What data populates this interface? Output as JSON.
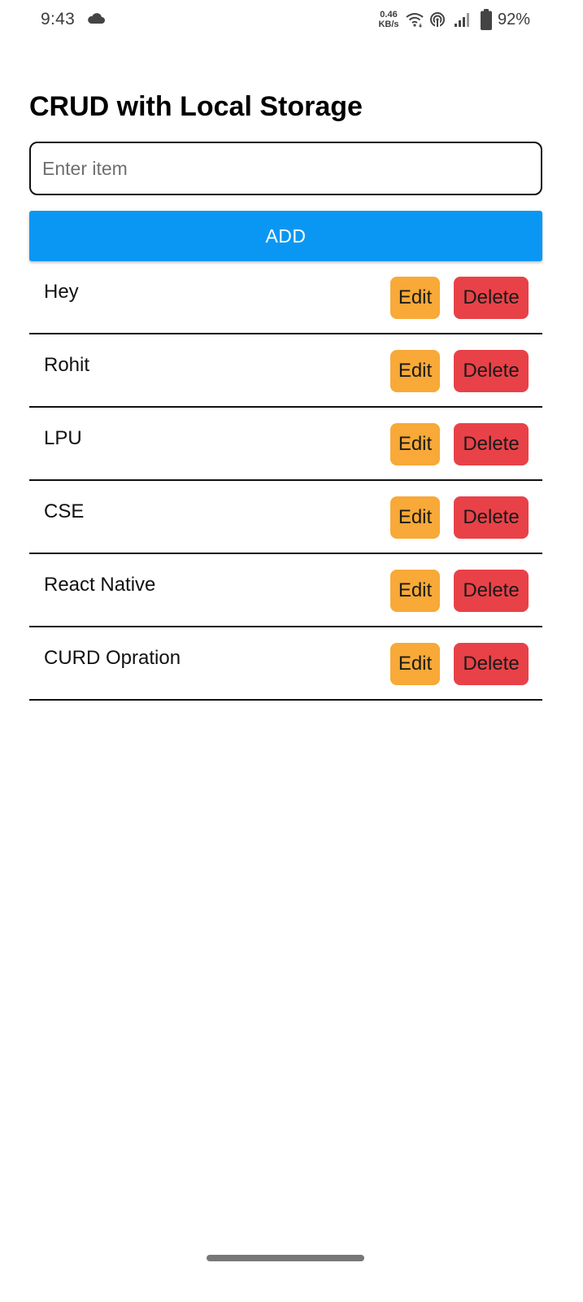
{
  "status_bar": {
    "time": "9:43",
    "net_speed_value": "0.46",
    "net_speed_unit": "KB/s",
    "battery": "92%",
    "icons": [
      "cloud-icon",
      "wifi-icon",
      "hotspot-icon",
      "signal-icon",
      "battery-icon"
    ]
  },
  "app": {
    "title": "CRUD with Local Storage",
    "input": {
      "placeholder": "Enter item",
      "value": ""
    },
    "add_label": "ADD",
    "colors": {
      "add_button": "#0a97f3",
      "edit_button": "#f8a937",
      "delete_button": "#e94148"
    },
    "items": [
      {
        "text": "Hey",
        "edit_label": "Edit",
        "delete_label": "Delete"
      },
      {
        "text": "Rohit",
        "edit_label": "Edit",
        "delete_label": "Delete"
      },
      {
        "text": "LPU",
        "edit_label": "Edit",
        "delete_label": "Delete"
      },
      {
        "text": "CSE",
        "edit_label": "Edit",
        "delete_label": "Delete"
      },
      {
        "text": "React Native",
        "edit_label": "Edit",
        "delete_label": "Delete"
      },
      {
        "text": "CURD Opration",
        "edit_label": "Edit",
        "delete_label": "Delete"
      }
    ]
  }
}
